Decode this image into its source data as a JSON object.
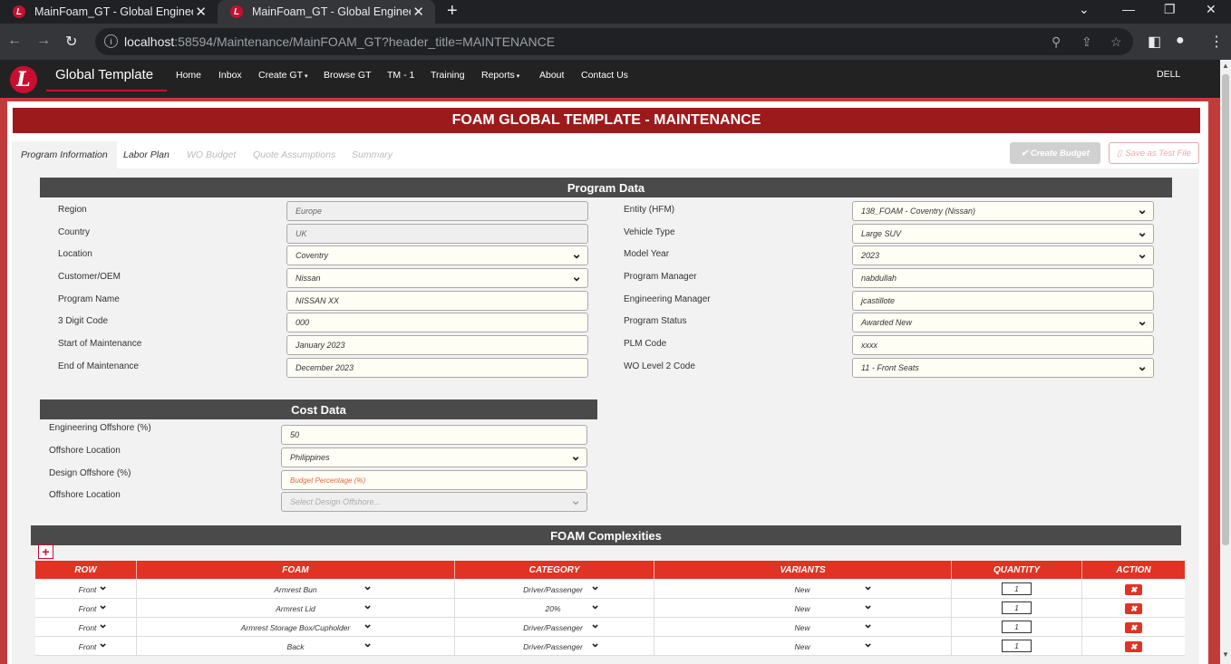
{
  "browser": {
    "tabs": [
      {
        "title": "MainFoam_GT - Global Engineeri"
      },
      {
        "title": "MainFoam_GT - Global Engineeri"
      }
    ],
    "new_tab": "+",
    "url_host": "localhost",
    "url_path": ":58594/Maintenance/MainFOAM_GT?header_title=MAINTENANCE",
    "icons": [
      "back-icon",
      "forward-icon",
      "reload-icon",
      "info-icon",
      "zoom-icon",
      "share-icon",
      "star-icon",
      "sidepanel-icon",
      "profile-icon",
      "menu-icon",
      "minimize-icon",
      "restore-icon",
      "close-icon"
    ]
  },
  "app_nav": {
    "logo": "L",
    "brand": "Global Template",
    "items": [
      "Home",
      "Inbox",
      "Create GT",
      "Browse GT",
      "TM - 1",
      "Training",
      "Reports",
      "About",
      "Contact Us"
    ],
    "user": "DELL"
  },
  "page": {
    "banner": "FOAM GLOBAL TEMPLATE - MAINTENANCE",
    "tabs": [
      "Program Information",
      "Labor Plan",
      "WO Budget",
      "Quote Assumptions",
      "Summary"
    ],
    "create_budget": "✔ Create Budget",
    "save_test": "Save as Test File"
  },
  "program_data": {
    "title": "Program Data",
    "left": [
      {
        "label": "Region",
        "value": "Europe"
      },
      {
        "label": "Country",
        "value": "UK"
      },
      {
        "label": "Location",
        "value": "Coventry"
      },
      {
        "label": "Customer/OEM",
        "value": "Nissan"
      },
      {
        "label": "Program Name",
        "value": "NISSAN XX"
      },
      {
        "label": "3 Digit Code",
        "value": "000"
      },
      {
        "label": "Start of Maintenance",
        "value": "January 2023"
      },
      {
        "label": "End of Maintenance",
        "value": "December 2023"
      }
    ],
    "right": [
      {
        "label": "Entity (HFM)",
        "value": "138_FOAM - Coventry (Nissan)"
      },
      {
        "label": "Vehicle Type",
        "value": "Large SUV"
      },
      {
        "label": "Model Year",
        "value": "2023"
      },
      {
        "label": "Program Manager",
        "value": "nabdullah"
      },
      {
        "label": "Engineering Manager",
        "value": "jcastillote"
      },
      {
        "label": "Program Status",
        "value": "Awarded New"
      },
      {
        "label": "PLM Code",
        "value": "xxxx"
      },
      {
        "label": "WO Level 2 Code",
        "value": "11 - Front Seats"
      }
    ]
  },
  "cost_data": {
    "title": "Cost Data",
    "fields": [
      {
        "label": "Engineering Offshore (%)",
        "value": "50"
      },
      {
        "label": "Offshore Location",
        "value": "Philippines"
      },
      {
        "label": "Design Offshore (%)",
        "value": "Budget Percentage (%)"
      },
      {
        "label": "Offshore Location",
        "value": "Select Design Offshore..."
      }
    ]
  },
  "complexities": {
    "title": "FOAM Complexities",
    "add": "+",
    "columns": [
      "ROW",
      "FOAM",
      "CATEGORY",
      "VARIANTS",
      "QUANTITY",
      "ACTION"
    ],
    "rows": [
      {
        "row": "Front",
        "foam": "Armrest Bun",
        "category": "Driver/Passenger",
        "variants": "New",
        "quantity": "1"
      },
      {
        "row": "Front",
        "foam": "Armrest Lid",
        "category": "20%",
        "variants": "New",
        "quantity": "1"
      },
      {
        "row": "Front",
        "foam": "Armrest Storage Box/Cupholder",
        "category": "Driver/Passenger",
        "variants": "New",
        "quantity": "1"
      },
      {
        "row": "Front",
        "foam": "Back",
        "category": "Driver/Passenger",
        "variants": "New",
        "quantity": "1"
      }
    ],
    "delete": "✖"
  }
}
